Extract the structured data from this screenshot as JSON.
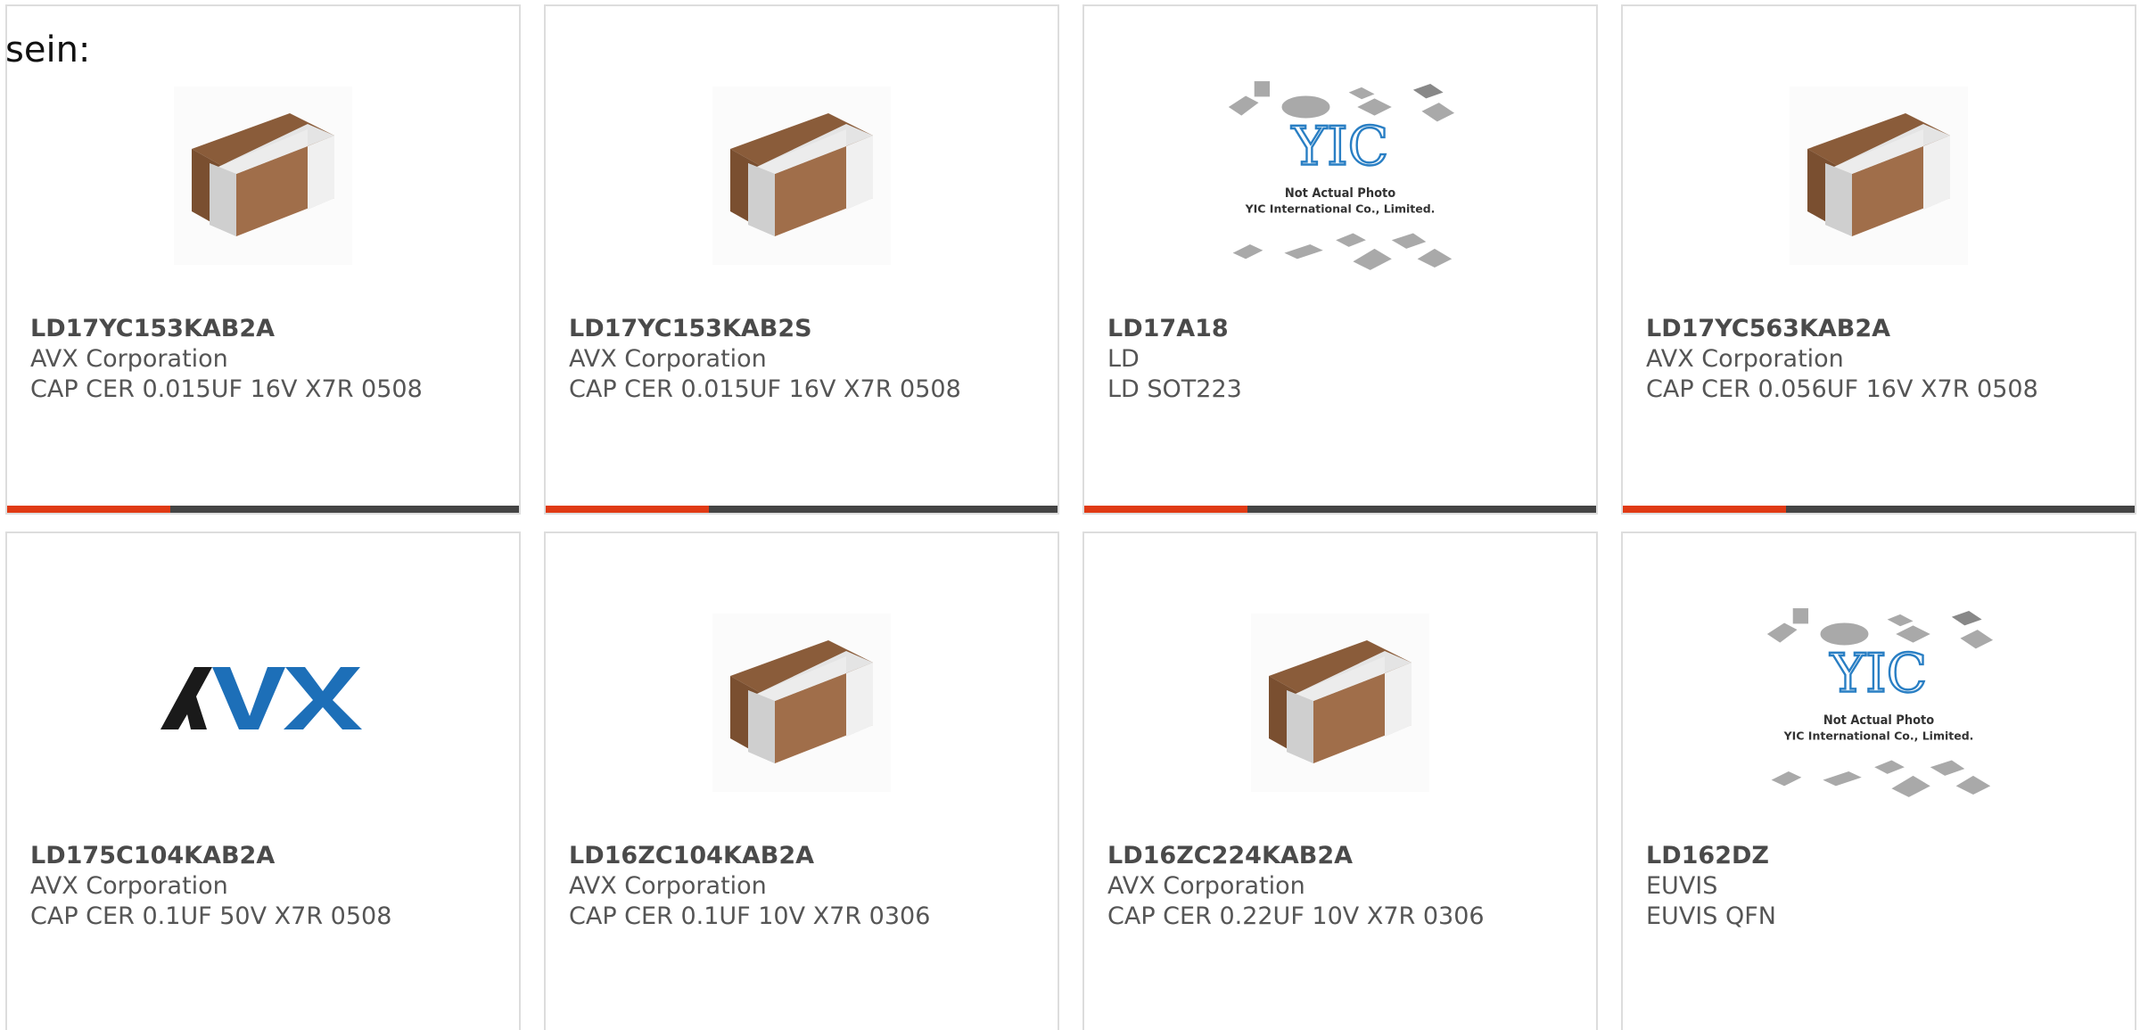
{
  "stray_text": "sein:",
  "products": [
    {
      "part": "LD17YC153KAB2A",
      "maker": "AVX Corporation",
      "desc": "CAP CER 0.015UF 16V X7R 0508",
      "image": "capacitor-chip"
    },
    {
      "part": "LD17YC153KAB2S",
      "maker": "AVX Corporation",
      "desc": "CAP CER 0.015UF 16V X7R 0508",
      "image": "capacitor-chip"
    },
    {
      "part": "LD17A18",
      "maker": "LD",
      "desc": "LD SOT223",
      "image": "yic-placeholder"
    },
    {
      "part": "LD17YC563KAB2A",
      "maker": "AVX Corporation",
      "desc": "CAP CER 0.056UF 16V X7R 0508",
      "image": "capacitor-chip"
    },
    {
      "part": "LD175C104KAB2A",
      "maker": "AVX Corporation",
      "desc": "CAP CER 0.1UF 50V X7R 0508",
      "image": "avx-logo"
    },
    {
      "part": "LD16ZC104KAB2A",
      "maker": "AVX Corporation",
      "desc": "CAP CER 0.1UF 10V X7R 0306",
      "image": "capacitor-chip"
    },
    {
      "part": "LD16ZC224KAB2A",
      "maker": "AVX Corporation",
      "desc": "CAP CER 0.22UF 10V X7R 0306",
      "image": "capacitor-chip"
    },
    {
      "part": "LD162DZ",
      "maker": "EUVIS",
      "desc": "EUVIS QFN",
      "image": "yic-placeholder"
    }
  ],
  "placeholder": {
    "line1": "Not Actual Photo",
    "line2": "YIC International Co., Limited.",
    "brand": "YIC"
  },
  "logo_text": "AVX",
  "colors": {
    "accent": "#e03a14",
    "bar": "#444444",
    "border": "#dddddd",
    "avx_dark": "#1a1a1a",
    "avx_blue": "#1d6fb8",
    "yic_blue": "#2a7fc4"
  }
}
